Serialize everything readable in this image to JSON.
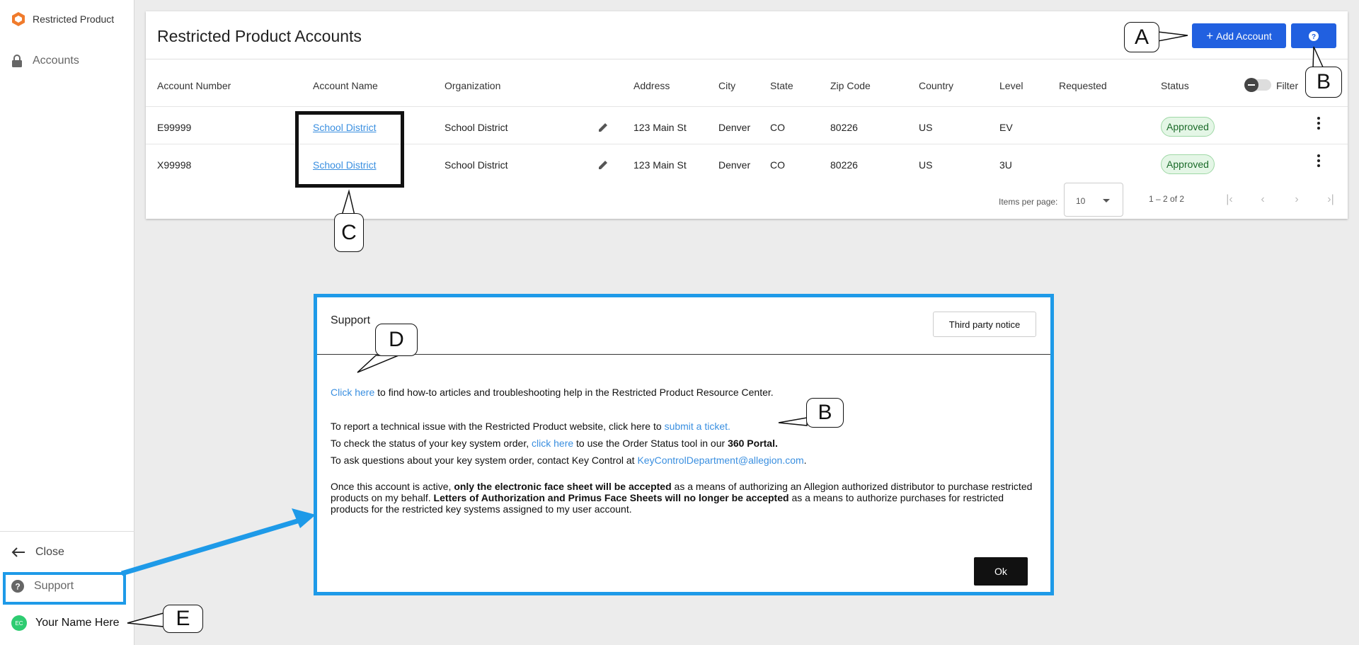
{
  "sidebar": {
    "brand": "Restricted Product",
    "accounts_label": "Accounts",
    "close_label": "Close",
    "support_label": "Support",
    "user_initials": "EC",
    "user_name": "Your Name Here"
  },
  "header": {
    "title": "Restricted Product Accounts",
    "add_account_label": "Add Account",
    "add_account_icon": "+"
  },
  "table": {
    "columns": [
      "Account Number",
      "Account Name",
      "Organization",
      "Address",
      "City",
      "State",
      "Zip Code",
      "Country",
      "Level",
      "Requested",
      "Status"
    ],
    "filter_label": "Filter",
    "rows": [
      {
        "account_number": "E99999",
        "account_name": "School District",
        "organization": "School District",
        "address": "123 Main St",
        "city": "Denver",
        "state": "CO",
        "zip": "80226",
        "country": "US",
        "level": "EV",
        "requested": "",
        "status": "Approved"
      },
      {
        "account_number": "X99998",
        "account_name": "School District",
        "organization": "School District",
        "address": "123 Main St",
        "city": "Denver",
        "state": "CO",
        "zip": "80226",
        "country": "US",
        "level": "3U",
        "requested": "",
        "status": "Approved"
      }
    ]
  },
  "pager": {
    "items_per_page_label": "Items per page:",
    "items_per_page": "10",
    "range": "1 – 2 of 2"
  },
  "callouts": {
    "a": "A",
    "b1": "B",
    "b2": "B",
    "c": "C",
    "d": "D",
    "e": "E"
  },
  "dialog": {
    "title": "Support",
    "third_party_label": "Third party notice",
    "line1_link": "Click here",
    "line1_text": " to find how-to articles and troubleshooting help in the Restricted Product Resource Center.",
    "line2_text": "To report a technical issue with the Restricted Product website, click here to ",
    "line2_link": "submit a ticket.",
    "line3_text": "To check the status of your key system order, ",
    "line3_link": "click here",
    "line3_text2": " to use the Order Status tool in our ",
    "line3_bold": "360 Portal.",
    "line4_text": "To ask questions about your key system order, contact Key Control at ",
    "line4_link": "KeyControlDepartment@allegion.com",
    "line4_end": ".",
    "para_1": "Once this account is active, ",
    "para_bold1": "only the electronic face sheet will be accepted",
    "para_2": " as a means of authorizing an Allegion authorized distributor to purchase restricted products on my behalf. ",
    "para_bold2": "Letters of Authorization and Primus Face Sheets will no longer be accepted",
    "para_3": " as a means to authorize purchases for restricted products for the restricted key systems assigned to my user account.",
    "ok_label": "Ok"
  },
  "colors": {
    "primary": "#2160e0",
    "highlight": "#1e9ae8",
    "link": "#3a8fe0",
    "approved_bg": "#e4f6e6"
  }
}
